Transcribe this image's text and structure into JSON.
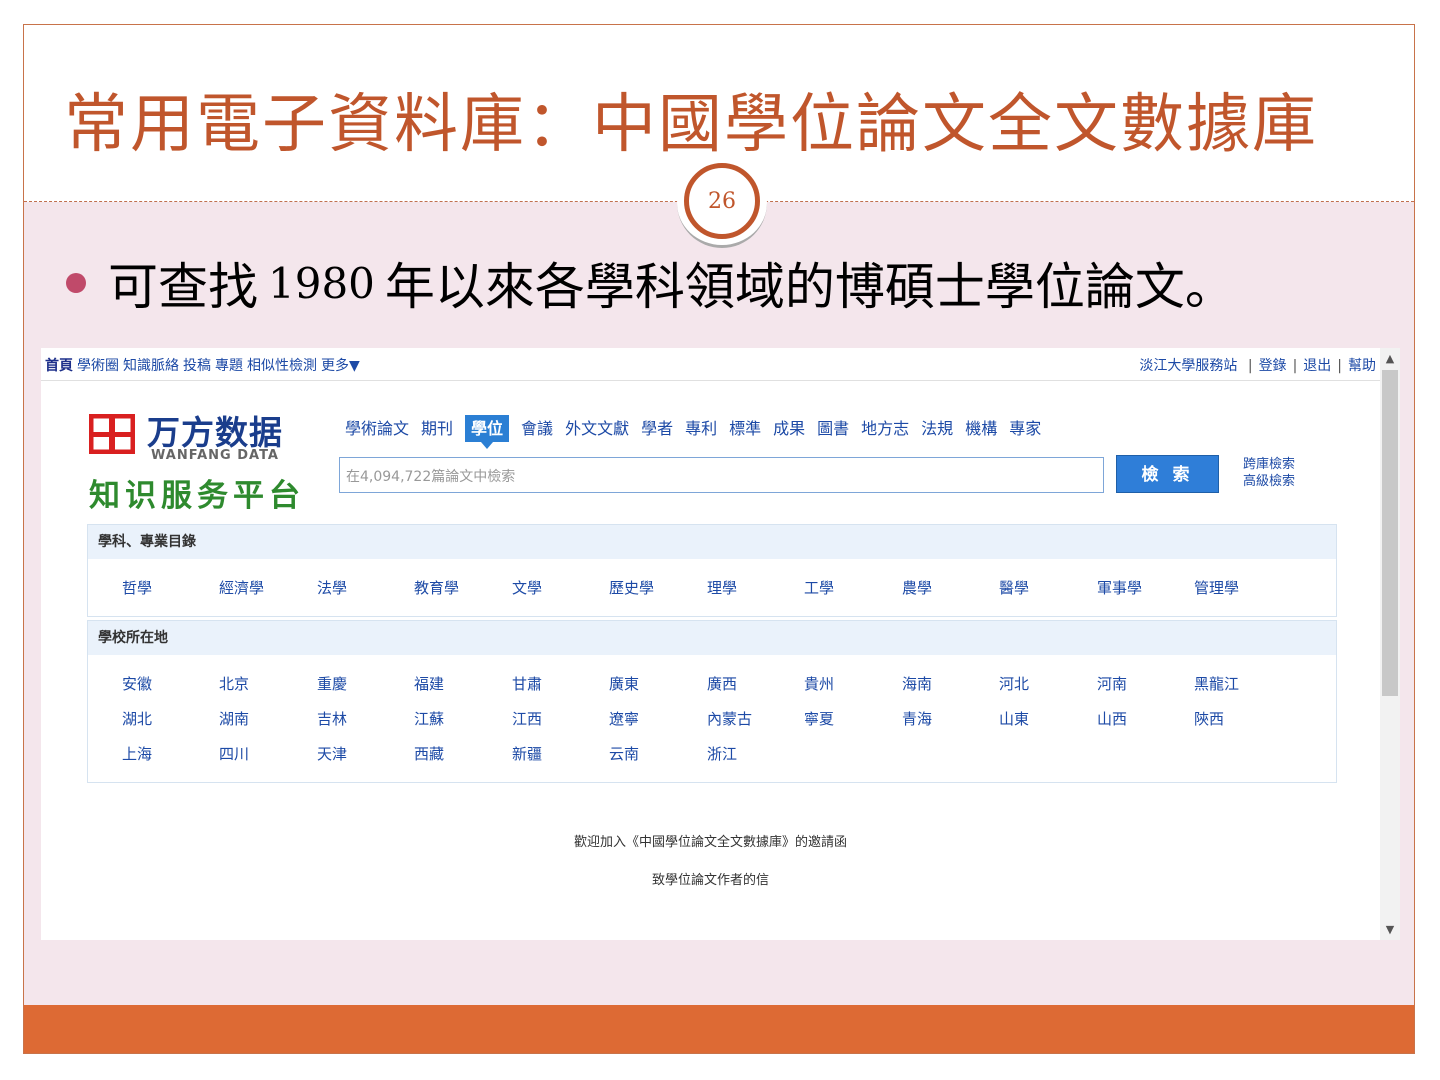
{
  "slide": {
    "title": "常用電子資料庫：中國學位論文全文數據庫",
    "page_number": "26",
    "bullet_pre": "可查找",
    "bullet_year": "1980",
    "bullet_post": "年以來各學科領域的博碩士學位論文。"
  },
  "topnav": {
    "left_items": [
      "首頁",
      "學術圈",
      "知識脈絡",
      "投稿",
      "專題",
      "相似性檢測",
      "更多▼"
    ],
    "site": "淡江大學服務站",
    "login": "登錄",
    "logout": "退出",
    "help": "幫助"
  },
  "logo": {
    "brand_cn": "万方数据",
    "brand_en": "WANFANG DATA",
    "slogan": "知识服务平台"
  },
  "categories": [
    "學術論文",
    "期刊",
    "學位",
    "會議",
    "外文文獻",
    "學者",
    "專利",
    "標準",
    "成果",
    "圖書",
    "地方志",
    "法規",
    "機構",
    "專家"
  ],
  "active_category": "學位",
  "search": {
    "placeholder": "在4,094,722篇論文中檢索",
    "button": "檢 索",
    "cross_db": "跨庫檢索",
    "advanced": "高級檢索"
  },
  "subjects": {
    "heading": "學科、專業目錄",
    "items": [
      "哲學",
      "經濟學",
      "法學",
      "教育學",
      "文學",
      "歷史學",
      "理學",
      "工學",
      "農學",
      "醫學",
      "軍事學",
      "管理學"
    ]
  },
  "locations": {
    "heading": "學校所在地",
    "items": [
      "安徽",
      "北京",
      "重慶",
      "福建",
      "甘肅",
      "廣東",
      "廣西",
      "貴州",
      "海南",
      "河北",
      "河南",
      "黑龍江",
      "湖北",
      "湖南",
      "吉林",
      "江蘇",
      "江西",
      "遼寧",
      "內蒙古",
      "寧夏",
      "青海",
      "山東",
      "山西",
      "陝西",
      "上海",
      "四川",
      "天津",
      "西藏",
      "新疆",
      "云南",
      "浙江"
    ]
  },
  "footer_links": {
    "invite": "歡迎加入《中國學位論文全文數據庫》的邀請函",
    "letter": "致學位論文作者的信"
  },
  "colors": {
    "title": "#c0562c",
    "footer_bar": "#dd6a34",
    "content_bg": "#f4e6ec",
    "bullet": "#c04a6a",
    "link": "#1d4aa6",
    "accent": "#2b7fd4"
  }
}
